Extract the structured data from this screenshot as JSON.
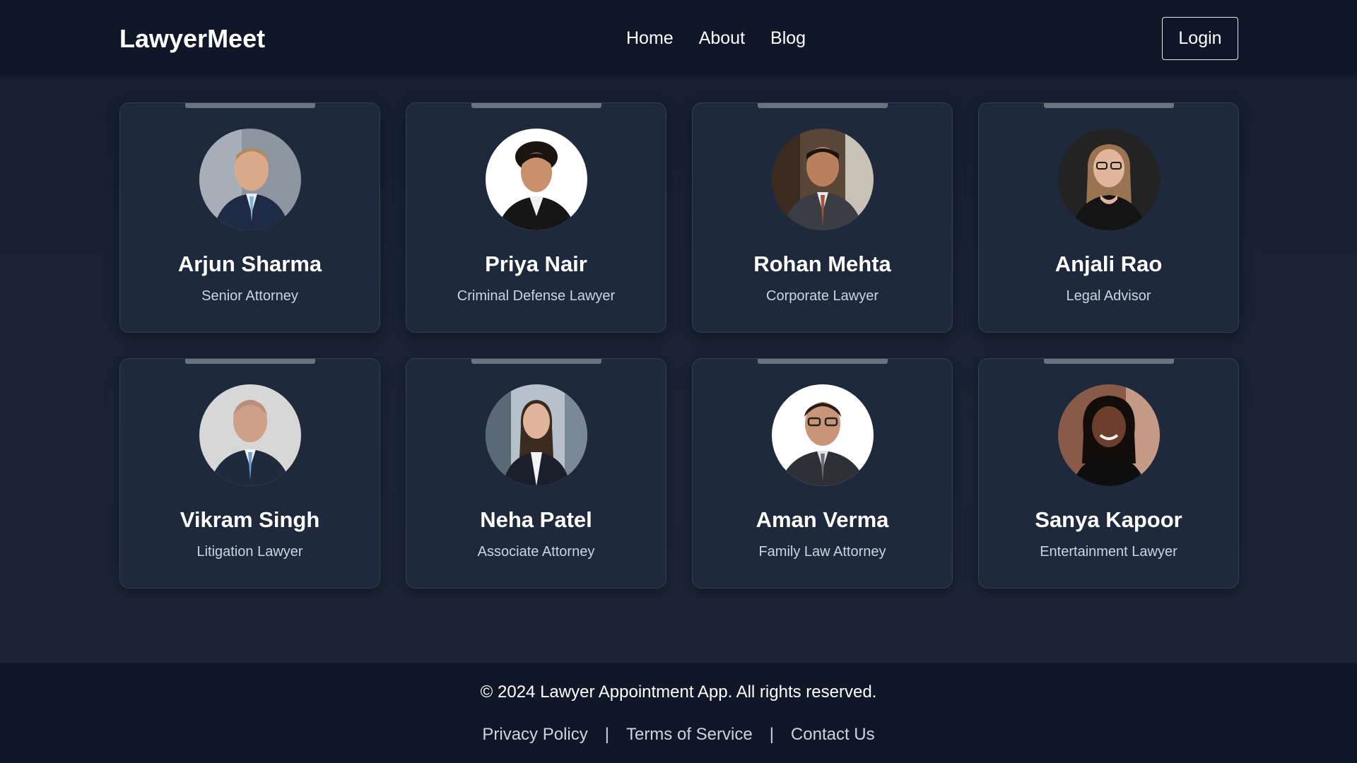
{
  "brand": "LawyerMeet",
  "nav": {
    "items": [
      "Home",
      "About",
      "Blog"
    ],
    "login_label": "Login"
  },
  "lawyers": [
    {
      "name": "Arjun Sharma",
      "role": "Senior Attorney"
    },
    {
      "name": "Priya Nair",
      "role": "Criminal Defense Lawyer"
    },
    {
      "name": "Rohan Mehta",
      "role": "Corporate Lawyer"
    },
    {
      "name": "Anjali Rao",
      "role": "Legal Advisor"
    },
    {
      "name": "Vikram Singh",
      "role": "Litigation Lawyer"
    },
    {
      "name": "Neha Patel",
      "role": "Associate Attorney"
    },
    {
      "name": "Aman Verma",
      "role": "Family Law Attorney"
    },
    {
      "name": "Sanya Kapoor",
      "role": "Entertainment Lawyer"
    }
  ],
  "footer": {
    "copyright": "© 2024 Lawyer Appointment App. All rights reserved.",
    "links": [
      "Privacy Policy",
      "Terms of Service",
      "Contact Us"
    ],
    "separator": "|"
  },
  "colors": {
    "background": "#0f1729",
    "card": "#1e293b",
    "card_border": "#334155",
    "muted_text": "#cbd5e1"
  }
}
